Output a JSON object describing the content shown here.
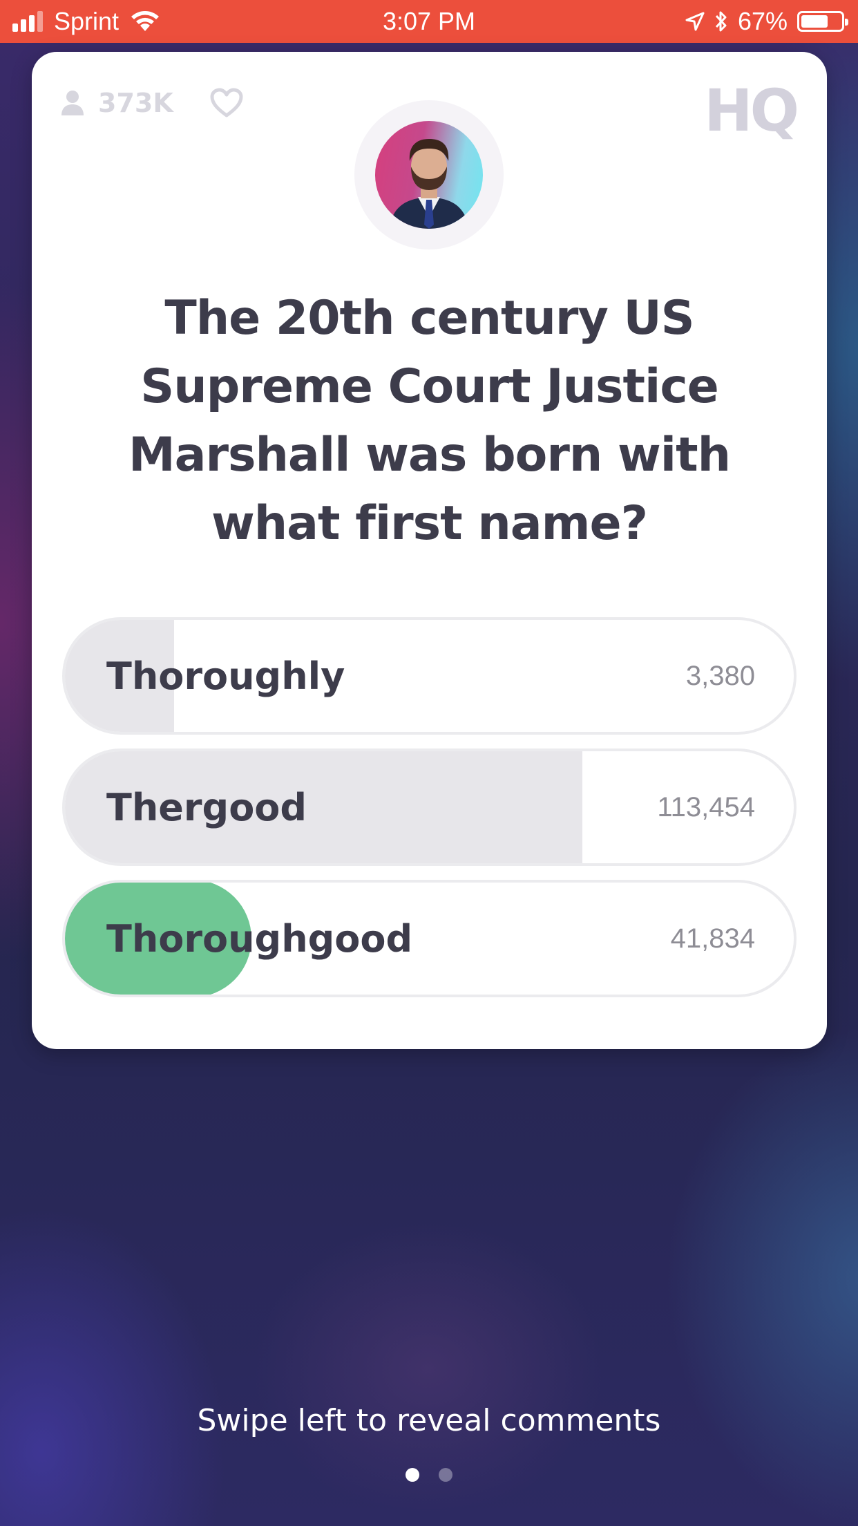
{
  "status_bar": {
    "carrier": "Sprint",
    "time": "3:07 PM",
    "battery_percent": "67%",
    "battery_level": 0.67,
    "icons": [
      "signal-icon",
      "wifi-icon",
      "location-arrow-icon",
      "bluetooth-icon",
      "battery-icon"
    ]
  },
  "card": {
    "viewer_count": "373K",
    "logo": "HQ",
    "question": "The 20th century US Supreme Court Justice Marshall was born with what first name?",
    "answers": [
      {
        "label": "Thoroughly",
        "count": "3,380",
        "share": 0.15,
        "correct": false
      },
      {
        "label": "Thergood",
        "count": "113,454",
        "share": 0.71,
        "correct": false
      },
      {
        "label": "Thoroughgood",
        "count": "41,834",
        "share": 0.26,
        "correct": true
      }
    ],
    "colors": {
      "correct": "#6fc794",
      "bar": "#e7e6ea",
      "text": "#3d3c4b"
    }
  },
  "footer": {
    "hint": "Swipe left to reveal comments",
    "page_dots": 2,
    "active_dot": 0
  },
  "colors": {
    "status_bar": "#ec4f3c",
    "background": "#2a2756"
  }
}
